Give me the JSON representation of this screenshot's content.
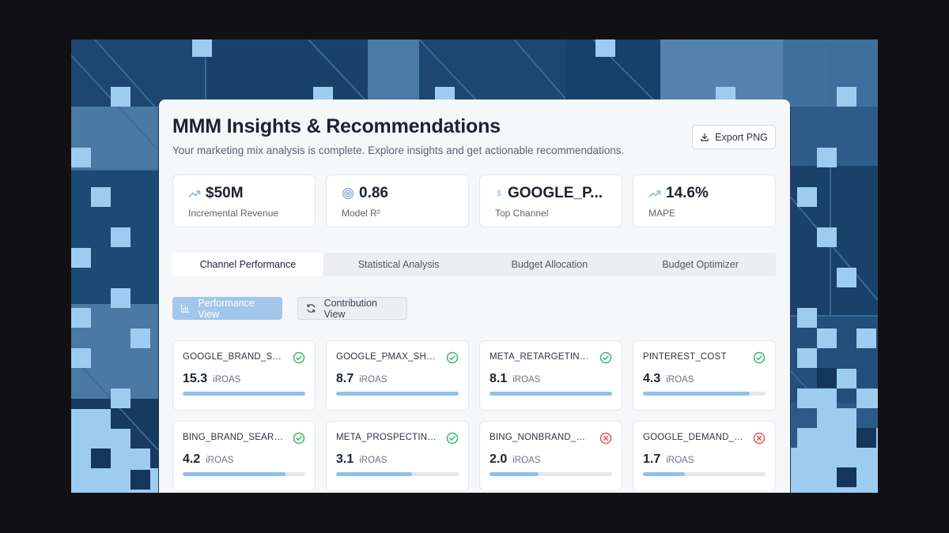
{
  "header": {
    "title": "MMM Insights & Recommendations",
    "subtitle": "Your marketing mix analysis is complete. Explore insights and get actionable recommendations.",
    "export_label": "Export PNG"
  },
  "kpis": [
    {
      "icon": "trending-up-icon",
      "value": "$50M",
      "label": "Incremental Revenue"
    },
    {
      "icon": "target-icon",
      "value": "0.86",
      "label": "Model R²"
    },
    {
      "icon": "dollar-icon",
      "value": "GOOGLE_P...",
      "label": "Top Channel"
    },
    {
      "icon": "trending-up-icon",
      "value": "14.6%",
      "label": "MAPE"
    }
  ],
  "tabs": [
    "Channel Performance",
    "Statistical Analysis",
    "Budget Allocation",
    "Budget Optimizer"
  ],
  "active_tab": "Channel Performance",
  "views": {
    "performance_label": "Performance View",
    "contribution_label": "Contribution View"
  },
  "channels": [
    {
      "name": "GOOGLE_BRAND_SEARCH",
      "display": "GOOGLE_BRAND_SEAR...",
      "value": "15.3",
      "unit": "iROAS",
      "status": "good",
      "fill": 1.0
    },
    {
      "name": "GOOGLE_PMAX_SHOPPING",
      "display": "GOOGLE_PMAX_SHOPPI...",
      "value": "8.7",
      "unit": "iROAS",
      "status": "good",
      "fill": 1.0
    },
    {
      "name": "META_RETARGETING_C",
      "display": "META_RETARGETING_C...",
      "value": "8.1",
      "unit": "iROAS",
      "status": "good",
      "fill": 1.0
    },
    {
      "name": "PINTEREST_COST",
      "display": "PINTEREST_COST",
      "value": "4.3",
      "unit": "iROAS",
      "status": "good",
      "fill": 0.87
    },
    {
      "name": "BING_BRAND_SEARCH",
      "display": "BING_BRAND_SEARCH_...",
      "value": "4.2",
      "unit": "iROAS",
      "status": "good",
      "fill": 0.84
    },
    {
      "name": "META_PROSPECTING_C",
      "display": "META_PROSPECTING_C...",
      "value": "3.1",
      "unit": "iROAS",
      "status": "good",
      "fill": 0.62
    },
    {
      "name": "BING_NONBRAND_PMAX",
      "display": "BING_NONBRAND_PMA...",
      "value": "2.0",
      "unit": "iROAS",
      "status": "bad",
      "fill": 0.4
    },
    {
      "name": "GOOGLE_DEMAND_GEN",
      "display": "GOOGLE_DEMAND_GE...",
      "value": "1.7",
      "unit": "iROAS",
      "status": "bad",
      "fill": 0.34
    }
  ],
  "colors": {
    "accent": "#8fc0ec",
    "good": "#35b86b",
    "bad": "#e25656",
    "background_frame": "#1f4a74"
  }
}
